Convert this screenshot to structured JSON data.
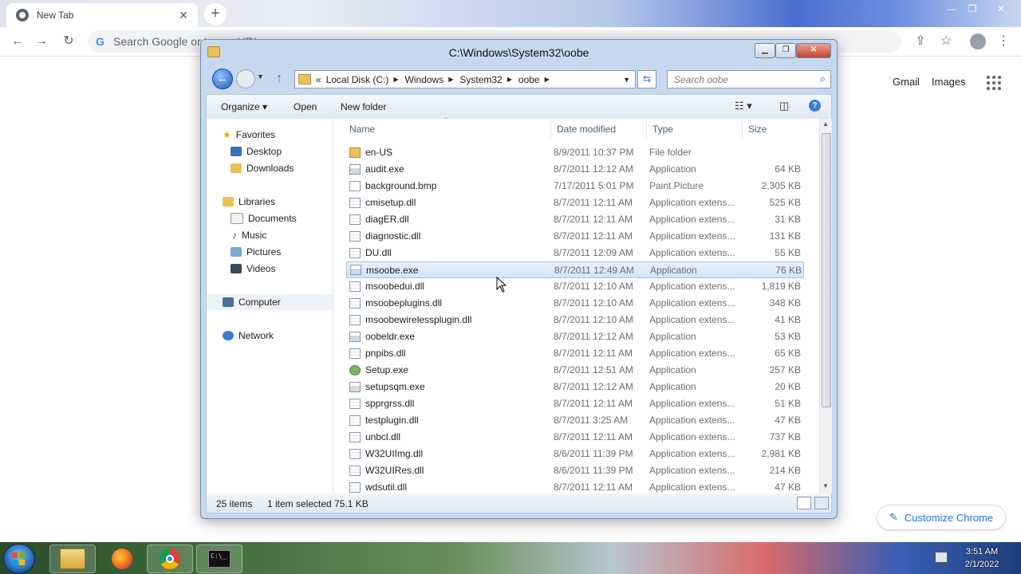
{
  "chrome": {
    "tab_title": "New Tab",
    "tab_close": "✕",
    "new_tab": "+",
    "omnibox_placeholder": "Search Google or type a URL",
    "header_links": [
      "Gmail",
      "Images"
    ],
    "customize_label": "Customize Chrome",
    "window_controls": [
      "—",
      "❐",
      "✕"
    ]
  },
  "explorer": {
    "title": "C:\\Windows\\System32\\oobe",
    "breadcrumb": [
      "Local Disk (C:)",
      "Windows",
      "System32",
      "oobe"
    ],
    "search_placeholder": "Search oobe",
    "commands": [
      "Organize",
      "Open",
      "New folder"
    ],
    "nav": {
      "favorites": "Favorites",
      "favorites_items": [
        "Desktop",
        "Downloads"
      ],
      "libraries": "Libraries",
      "libraries_items": [
        "Documents",
        "Music",
        "Pictures",
        "Videos"
      ],
      "computer": "Computer",
      "network": "Network"
    },
    "columns": [
      "Name",
      "Date modified",
      "Type",
      "Size"
    ],
    "files": [
      {
        "name": "en-US",
        "date": "8/9/2011 10:37 PM",
        "type": "File folder",
        "size": "",
        "icon": "folder"
      },
      {
        "name": "audit.exe",
        "date": "8/7/2011 12:12 AM",
        "type": "Application",
        "size": "64 KB",
        "icon": "app"
      },
      {
        "name": "background.bmp",
        "date": "7/17/2011 5:01 PM",
        "type": "Paint.Picture",
        "size": "2,305 KB",
        "icon": "file"
      },
      {
        "name": "cmisetup.dll",
        "date": "8/7/2011 12:11 AM",
        "type": "Application extens...",
        "size": "525 KB",
        "icon": "dll"
      },
      {
        "name": "diagER.dll",
        "date": "8/7/2011 12:11 AM",
        "type": "Application extens...",
        "size": "31 KB",
        "icon": "dll"
      },
      {
        "name": "diagnostic.dll",
        "date": "8/7/2011 12:11 AM",
        "type": "Application extens...",
        "size": "131 KB",
        "icon": "dll"
      },
      {
        "name": "DU.dll",
        "date": "8/7/2011 12:09 AM",
        "type": "Application extens...",
        "size": "55 KB",
        "icon": "dll"
      },
      {
        "name": "msoobe.exe",
        "date": "8/7/2011 12:49 AM",
        "type": "Application",
        "size": "76 KB",
        "icon": "app"
      },
      {
        "name": "msoobedui.dll",
        "date": "8/7/2011 12:10 AM",
        "type": "Application extens...",
        "size": "1,819 KB",
        "icon": "dll"
      },
      {
        "name": "msoobeplugins.dll",
        "date": "8/7/2011 12:10 AM",
        "type": "Application extens...",
        "size": "348 KB",
        "icon": "dll"
      },
      {
        "name": "msoobewirelessplugin.dll",
        "date": "8/7/2011 12:10 AM",
        "type": "Application extens...",
        "size": "41 KB",
        "icon": "dll"
      },
      {
        "name": "oobeldr.exe",
        "date": "8/7/2011 12:12 AM",
        "type": "Application",
        "size": "53 KB",
        "icon": "app"
      },
      {
        "name": "pnpibs.dll",
        "date": "8/7/2011 12:11 AM",
        "type": "Application extens...",
        "size": "65 KB",
        "icon": "dll"
      },
      {
        "name": "Setup.exe",
        "date": "8/7/2011 12:51 AM",
        "type": "Application",
        "size": "257 KB",
        "icon": "setup"
      },
      {
        "name": "setupsqm.exe",
        "date": "8/7/2011 12:12 AM",
        "type": "Application",
        "size": "20 KB",
        "icon": "app"
      },
      {
        "name": "spprgrss.dll",
        "date": "8/7/2011 12:11 AM",
        "type": "Application extens...",
        "size": "51 KB",
        "icon": "dll"
      },
      {
        "name": "testplugin.dll",
        "date": "8/7/2011 3:25 AM",
        "type": "Application extens...",
        "size": "47 KB",
        "icon": "dll"
      },
      {
        "name": "unbcl.dll",
        "date": "8/7/2011 12:11 AM",
        "type": "Application extens...",
        "size": "737 KB",
        "icon": "dll"
      },
      {
        "name": "W32UIImg.dll",
        "date": "8/6/2011 11:39 PM",
        "type": "Application extens...",
        "size": "2,981 KB",
        "icon": "dll"
      },
      {
        "name": "W32UIRes.dll",
        "date": "8/6/2011 11:39 PM",
        "type": "Application extens...",
        "size": "214 KB",
        "icon": "dll"
      },
      {
        "name": "wdsutil.dll",
        "date": "8/7/2011 12:11 AM",
        "type": "Application extens...",
        "size": "47 KB",
        "icon": "dll"
      }
    ],
    "selected_file": "msoobe.exe",
    "status": {
      "count": "25 items",
      "selection": "1 item selected  75.1 KB"
    }
  },
  "taskbar": {
    "time": "3:51 AM",
    "date": "2/1/2022",
    "cmd_label": "C:\\_"
  }
}
